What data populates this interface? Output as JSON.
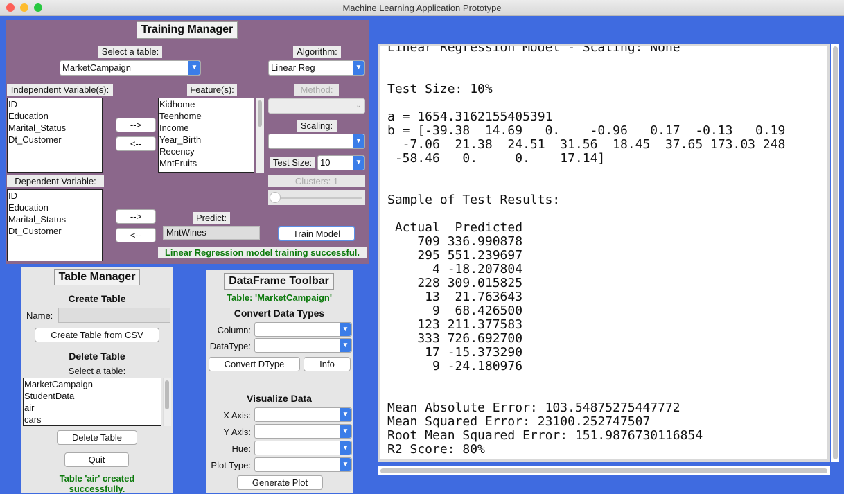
{
  "window": {
    "title": "Machine Learning Application Prototype"
  },
  "training": {
    "header": "Training Manager",
    "select_table_label": "Select a table:",
    "table_value": "MarketCampaign",
    "algorithm_label": "Algorithm:",
    "algorithm_value": "Linear Reg",
    "indep_label": "Independent Variable(s):",
    "indep_items": [
      "ID",
      "Education",
      "Marital_Status",
      "Dt_Customer"
    ],
    "features_label": "Feature(s):",
    "features_items": [
      "Kidhome",
      "Teenhome",
      "Income",
      "Year_Birth",
      "Recency",
      "MntFruits"
    ],
    "method_label": "Method:",
    "scaling_label": "Scaling:",
    "test_size_label": "Test Size:",
    "test_size_value": "10",
    "dep_label": "Dependent Variable:",
    "dep_items": [
      "ID",
      "Education",
      "Marital_Status",
      "Dt_Customer"
    ],
    "clusters_label": "Clusters: 1",
    "clusters_slider_value": 1,
    "add_arrow": "-->",
    "remove_arrow": "<--",
    "predict_label": "Predict:",
    "predict_value": "MntWines",
    "train_button": "Train Model",
    "status": "Linear Regression model training successful."
  },
  "table_manager": {
    "header": "Table Manager",
    "create_title": "Create Table",
    "name_label": "Name:",
    "name_value": "",
    "create_button": "Create Table from CSV",
    "delete_title": "Delete Table",
    "select_label": "Select a table:",
    "tables": [
      "MarketCampaign",
      "StudentData",
      "air",
      "cars"
    ],
    "delete_button": "Delete Table",
    "quit_button": "Quit",
    "status_line1": "Table 'air' created",
    "status_line2": "successfully."
  },
  "dataframe": {
    "header": "DataFrame Toolbar",
    "table_label": "Table: 'MarketCampaign'",
    "convert_title": "Convert Data Types",
    "column_label": "Column:",
    "datatype_label": "DataType:",
    "convert_button": "Convert DType",
    "info_button": "Info",
    "viz_title": "Visualize Data",
    "x_label": "X Axis:",
    "y_label": "Y Axis:",
    "hue_label": "Hue:",
    "plot_type_label": "Plot Type:",
    "generate_button": "Generate Plot"
  },
  "output": {
    "lines": [
      "Linear Regression Model - Scaling: None",
      "",
      "",
      "Test Size: 10%",
      "",
      "a = 1654.3162155405391",
      "b = [-39.38  14.69   0.    -0.96   0.17  -0.13   0.19",
      "  -7.06  21.38  24.51  31.56  18.45  37.65 173.03 248",
      " -58.46   0.     0.    17.14]",
      "",
      "",
      "Sample of Test Results:",
      "",
      " Actual  Predicted",
      "    709 336.990878",
      "    295 551.239697",
      "      4 -18.207804",
      "    228 309.015825",
      "     13  21.763643",
      "      9  68.426500",
      "    123 211.377583",
      "    333 726.692700",
      "     17 -15.373290",
      "      9 -24.180976",
      "",
      "",
      "Mean Absolute Error: 103.54875275447772",
      "Mean Squared Error: 23100.252747507",
      "Root Mean Squared Error: 151.9876730116854",
      "R2 Score: 80%"
    ]
  }
}
